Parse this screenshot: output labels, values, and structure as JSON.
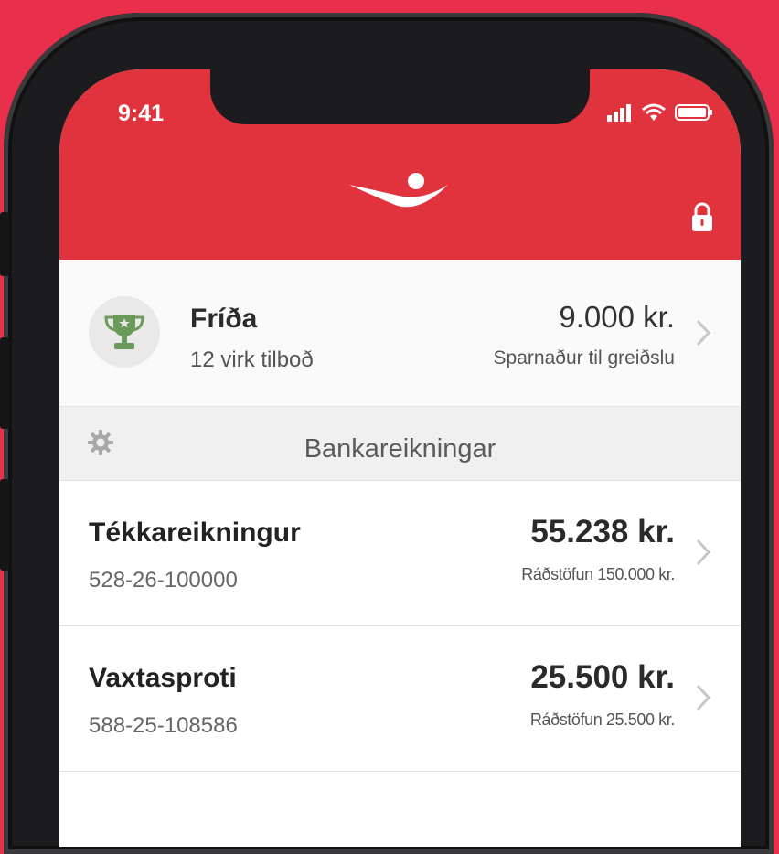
{
  "status_bar": {
    "time": "9:41"
  },
  "icons": {
    "logo": "bank-logo-icon",
    "lock": "lock-icon",
    "trophy": "trophy-icon",
    "gear": "gear-icon",
    "chevron": "chevron-right-icon",
    "signal": "signal-icon",
    "wifi": "wifi-icon",
    "battery": "battery-icon"
  },
  "colors": {
    "brand_red": "#e0333d",
    "background": "#e8304c",
    "trophy_green": "#6a9b5a"
  },
  "offers": {
    "title": "Fríða",
    "subtitle": "12 virk tilboð",
    "amount": "9.000 kr.",
    "amount_note": "Sparnaður til greiðslu"
  },
  "section": {
    "title": "Bankareikningar"
  },
  "accounts": [
    {
      "name": "Tékkareikningur",
      "number": "528-26-100000",
      "balance": "55.238 kr.",
      "available": "Ráðstöfun 150.000 kr."
    },
    {
      "name": "Vaxtasproti",
      "number": "588-25-108586",
      "balance": "25.500 kr.",
      "available": "Ráðstöfun 25.500 kr."
    }
  ]
}
